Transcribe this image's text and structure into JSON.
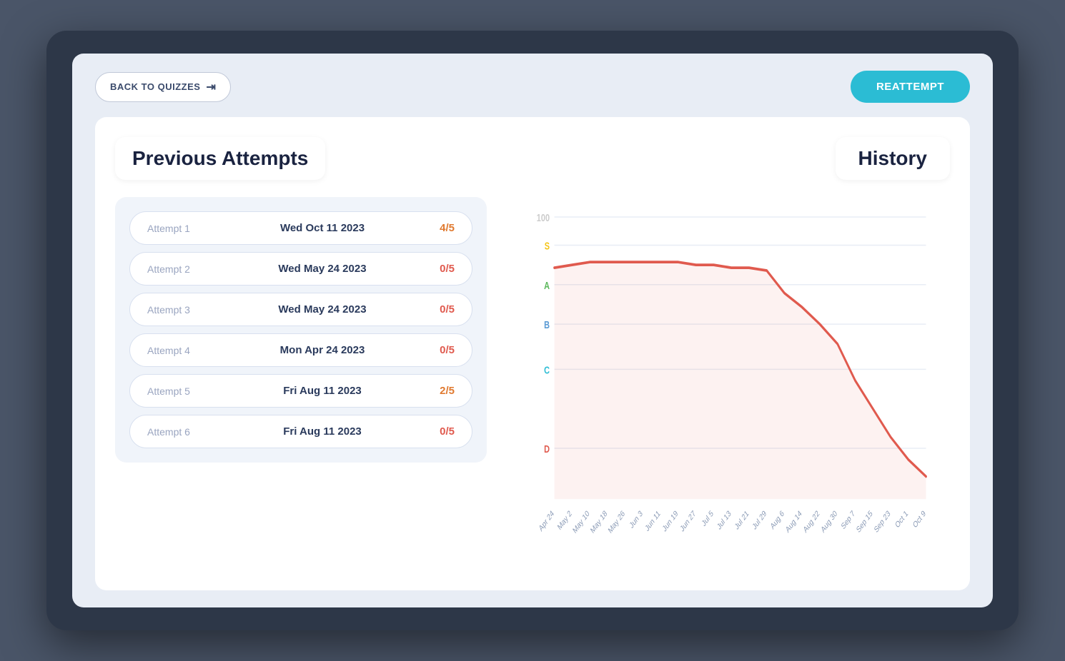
{
  "device": {
    "back_button_label": "BACK TO QUIZZES",
    "reattempt_label": "REATTEMPT"
  },
  "left_panel": {
    "title": "Previous Attempts",
    "attempts": [
      {
        "id": 1,
        "label": "Attempt 1",
        "date": "Wed Oct 11 2023",
        "score": "4/5",
        "score_color": "orange"
      },
      {
        "id": 2,
        "label": "Attempt 2",
        "date": "Wed May 24 2023",
        "score": "0/5",
        "score_color": "red"
      },
      {
        "id": 3,
        "label": "Attempt 3",
        "date": "Wed May 24 2023",
        "score": "0/5",
        "score_color": "red"
      },
      {
        "id": 4,
        "label": "Attempt 4",
        "date": "Mon Apr 24 2023",
        "score": "0/5",
        "score_color": "red"
      },
      {
        "id": 5,
        "label": "Attempt 5",
        "date": "Fri Aug 11 2023",
        "score": "2/5",
        "score_color": "orange"
      },
      {
        "id": 6,
        "label": "Attempt 6",
        "date": "Fri Aug 11 2023",
        "score": "0/5",
        "score_color": "red"
      }
    ]
  },
  "right_panel": {
    "title": "History",
    "chart": {
      "y_labels": [
        {
          "label": "100",
          "y_pct": 2
        },
        {
          "label": "S",
          "y_pct": 12,
          "color": "#f5c518"
        },
        {
          "label": "A",
          "y_pct": 26,
          "color": "#5cb85c"
        },
        {
          "label": "B",
          "y_pct": 40,
          "color": "#5b9bd5"
        },
        {
          "label": "C",
          "y_pct": 58,
          "color": "#2bbcd4"
        },
        {
          "label": "D",
          "y_pct": 82,
          "color": "#e05a4e"
        }
      ],
      "x_labels": [
        "Apr 24",
        "May 2",
        "May 10",
        "May 18",
        "May 26",
        "Jun 3",
        "Jun 11",
        "Jun 19",
        "Jun 27",
        "Jul 5",
        "Jul 13",
        "Jul 21",
        "Jul 29",
        "Aug 6",
        "Aug 14",
        "Aug 22",
        "Aug 30",
        "Sep 7",
        "Sep 15",
        "Sep 23",
        "Oct 1",
        "Oct 9"
      ],
      "line_color": "#e05a4e",
      "data_points": [
        82,
        83,
        84,
        84,
        84,
        84,
        84,
        84,
        83,
        83,
        82,
        82,
        81,
        73,
        68,
        62,
        55,
        42,
        32,
        22,
        14,
        8
      ]
    }
  }
}
